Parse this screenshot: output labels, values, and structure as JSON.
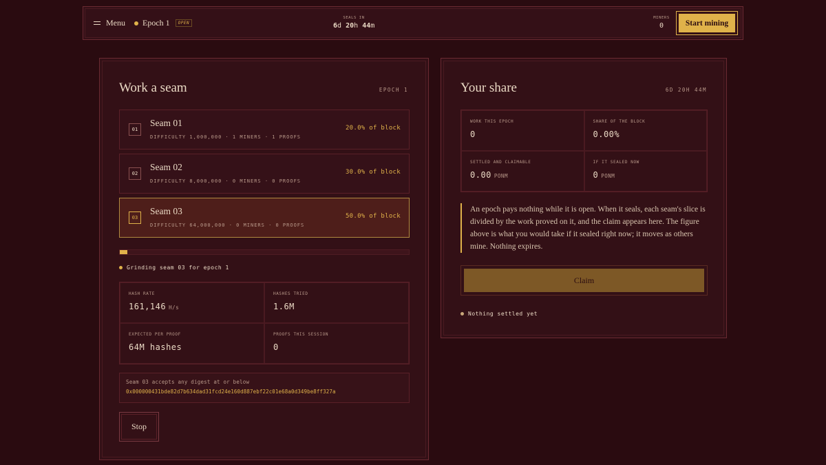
{
  "topbar": {
    "menu_label": "Menu",
    "epoch_label": "Epoch 1",
    "epoch_badge": "OPEN",
    "seals_in_label": "SEALS IN",
    "countdown": {
      "d": "6",
      "h": "20",
      "m": "44",
      "d_unit": "d",
      "h_unit": "h",
      "m_unit": "m"
    },
    "miners_label": "MINERS",
    "miners_count": "0",
    "start_label": "Start mining"
  },
  "work": {
    "title": "Work a seam",
    "tag": "EPOCH 1",
    "seams": [
      {
        "num": "01",
        "name": "Seam 01",
        "meta": "DIFFICULTY 1,000,000 · 1 MINERS · 1 PROOFS",
        "share": "20.0% of block",
        "active": false
      },
      {
        "num": "02",
        "name": "Seam 02",
        "meta": "DIFFICULTY 8,000,000 · 0 MINERS · 0 PROOFS",
        "share": "30.0% of block",
        "active": false
      },
      {
        "num": "03",
        "name": "Seam 03",
        "meta": "DIFFICULTY 64,000,000 · 0 MINERS · 0 PROOFS",
        "share": "50.0% of block",
        "active": true
      }
    ],
    "progress": 0.025,
    "status": "Grinding seam 03 for epoch 1",
    "stats": {
      "hash_rate_label": "HASH RATE",
      "hash_rate_value": "161,146",
      "hash_rate_unit": "H/s",
      "hashes_tried_label": "HASHES TRIED",
      "hashes_tried_value": "1.6M",
      "expected_label": "EXPECTED PER PROOF",
      "expected_value": "64M hashes",
      "proofs_label": "PROOFS THIS SESSION",
      "proofs_value": "0"
    },
    "digest_label": "Seam 03 accepts any digest at or below",
    "digest_value": "0x000000431bde82d7b634dad31fcd24e160d887ebf22c01e68a0d349be8ff327a",
    "stop_label": "Stop"
  },
  "share": {
    "title": "Your share",
    "tag": "6D 20H 44M",
    "stats": {
      "work_label": "WORK THIS EPOCH",
      "work_value": "0",
      "share_label": "SHARE OF THE BLOCK",
      "share_value": "0.00%",
      "settled_label": "SETTLED AND CLAIMABLE",
      "settled_value": "0.00",
      "settled_unit": "PONM",
      "sealed_label": "IF IT SEALED NOW",
      "sealed_value": "0",
      "sealed_unit": "PONM"
    },
    "note": "An epoch pays nothing while it is open. When it seals, each seam's slice is divided by the work proved on it, and the claim appears here. The figure above is what you would take if it sealed right now; it moves as others mine. Nothing expires.",
    "claim_label": "Claim",
    "status": "Nothing settled yet"
  },
  "colors": {
    "accent": "#e0b24a",
    "background": "#2a0b10",
    "panel": "#331016",
    "border": "#6a2a32"
  }
}
